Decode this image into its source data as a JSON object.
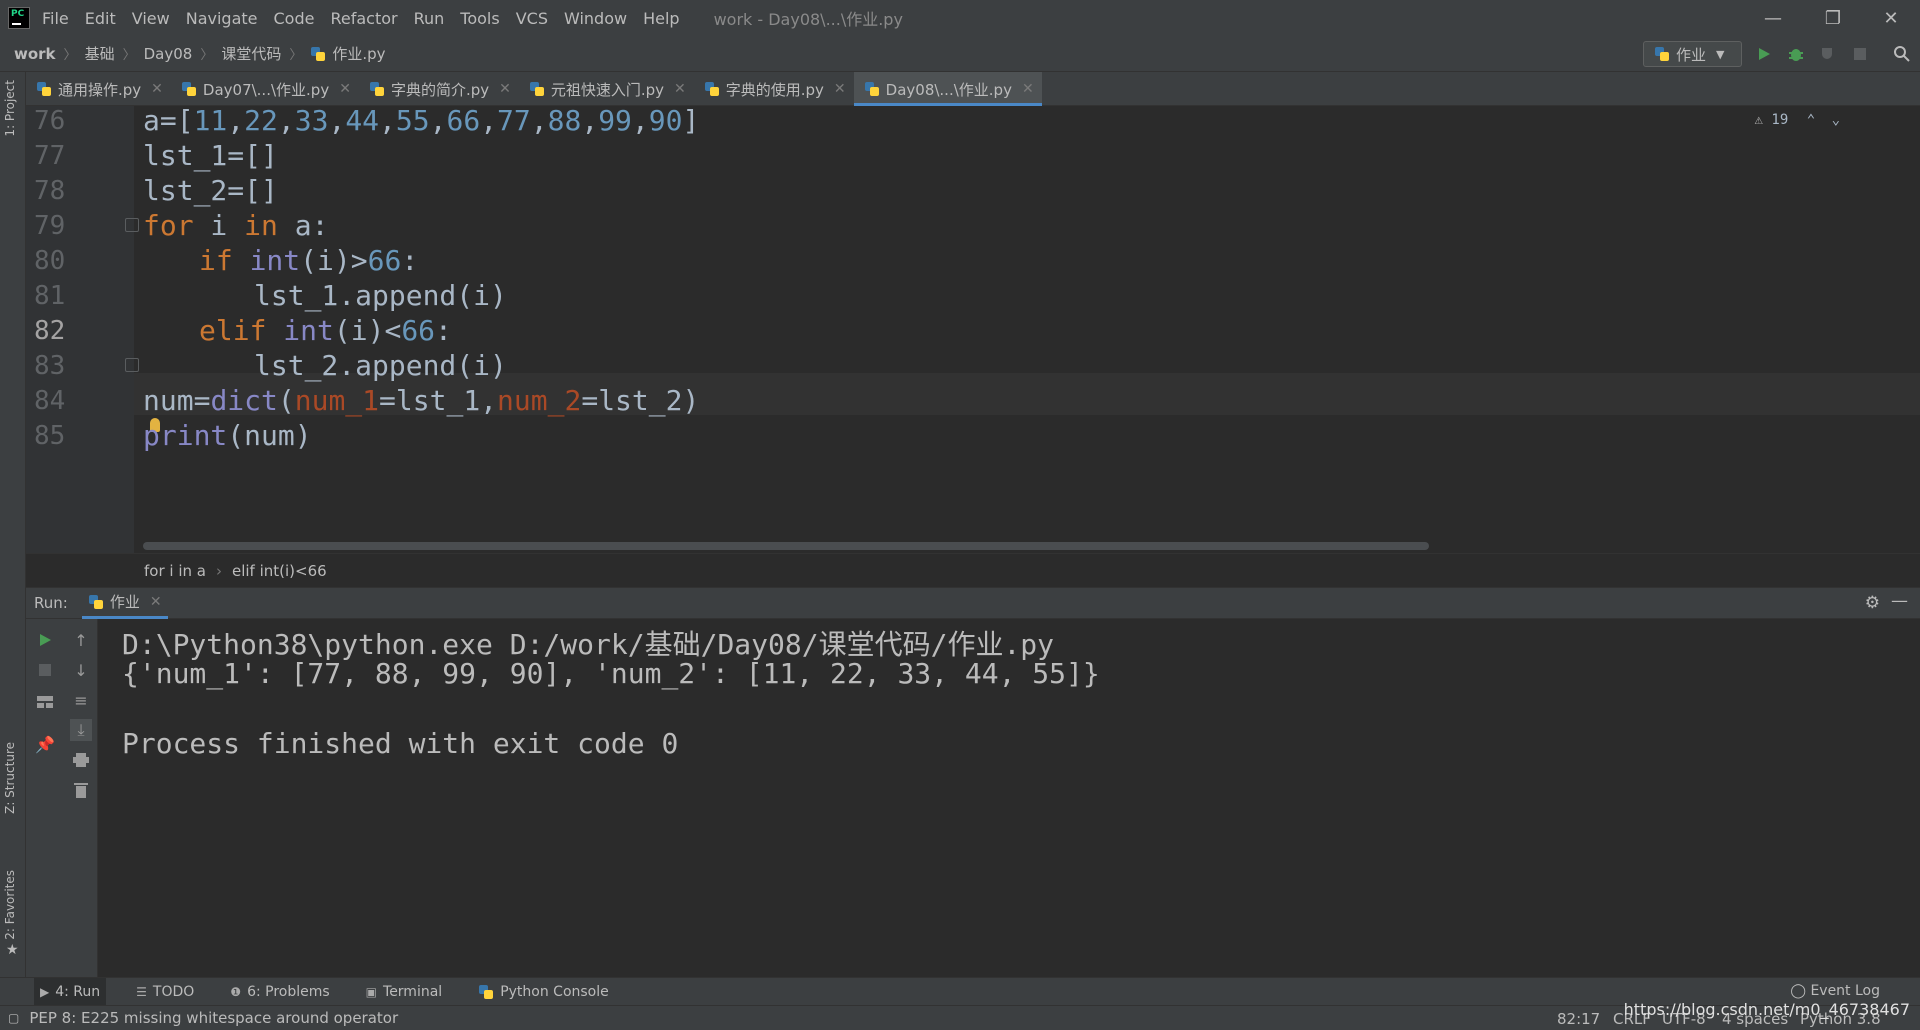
{
  "menu": [
    "File",
    "Edit",
    "View",
    "Navigate",
    "Code",
    "Refactor",
    "Run",
    "Tools",
    "VCS",
    "Window",
    "Help"
  ],
  "window_title": "work - Day08\\...\\作业.py",
  "window_controls": {
    "minimize": "—",
    "restore": "❐",
    "close": "✕"
  },
  "breadcrumb": [
    "work",
    "基础",
    "Day08",
    "课堂代码",
    "作业.py"
  ],
  "run_config": "作业",
  "left_stripe": {
    "project": "1: Project",
    "structure": "Z: Structure",
    "favorites": "2: Favorites"
  },
  "tabs": [
    {
      "label": "通用操作.py",
      "active": false
    },
    {
      "label": "Day07\\...\\作业.py",
      "active": false
    },
    {
      "label": "字典的简介.py",
      "active": false
    },
    {
      "label": "元祖快速入门.py",
      "active": false
    },
    {
      "label": "字典的使用.py",
      "active": false
    },
    {
      "label": "Day08\\...\\作业.py",
      "active": true
    }
  ],
  "editor": {
    "line_numbers": [
      "76",
      "77",
      "78",
      "79",
      "80",
      "81",
      "82",
      "83",
      "84",
      "85"
    ],
    "current_line": "82",
    "warning_count": "19",
    "code": {
      "l76_a": "a=[",
      "l76_nums": [
        "11",
        "22",
        "33",
        "44",
        "55",
        "66",
        "77",
        "88",
        "99",
        "90"
      ],
      "l76_end": "]",
      "l77": "lst_1=[]",
      "l78": "lst_2=[]",
      "l79_kw1": "for",
      "l79_mid": " i ",
      "l79_kw2": "in",
      "l79_end": " a:",
      "l80_kw": "if",
      "l80_bi": "int",
      "l80_mid": "(i)>",
      "l80_num": "66",
      "l80_end": ":",
      "l81": "lst_1.append(i)",
      "l82_kw": "elif",
      "l82_bi": "int",
      "l82_mid": "(i)<",
      "l82_num": "66",
      "l82_end": ":",
      "l83": "lst_2.append(i)",
      "l84_a": "num=",
      "l84_bi": "dict",
      "l84_b": "(",
      "l84_p1": "num_1",
      "l84_c": "=lst_1,",
      "l84_p2": "num_2",
      "l84_d": "=lst_2)",
      "l85_bi": "print",
      "l85_rest": "(num)"
    },
    "breadcrumb": [
      "for i in a",
      "elif int(i)<66"
    ]
  },
  "run_panel": {
    "label": "Run:",
    "tab": "作业",
    "console": [
      "D:\\Python38\\python.exe D:/work/基础/Day08/课堂代码/作业.py",
      "{'num_1': [77, 88, 99, 90], 'num_2': [11, 22, 33, 44, 55]}",
      "",
      "Process finished with exit code 0"
    ]
  },
  "bottom_tabs": [
    {
      "label": "4: Run",
      "icon": "play-icon",
      "active": true
    },
    {
      "label": "TODO",
      "icon": "list-icon",
      "active": false
    },
    {
      "label": "6: Problems",
      "icon": "info-icon",
      "active": false
    },
    {
      "label": "Terminal",
      "icon": "terminal-icon",
      "active": false
    },
    {
      "label": "Python Console",
      "icon": "python-icon",
      "active": false
    }
  ],
  "event_log": "Event Log",
  "status": {
    "message": "PEP 8: E225 missing whitespace around operator",
    "position": "82:17",
    "line_sep": "CRLF",
    "encoding": "UTF-8",
    "indent": "4 spaces",
    "interpreter": "Python 3.8"
  },
  "watermark": "https://blog.csdn.net/m0_46738467"
}
